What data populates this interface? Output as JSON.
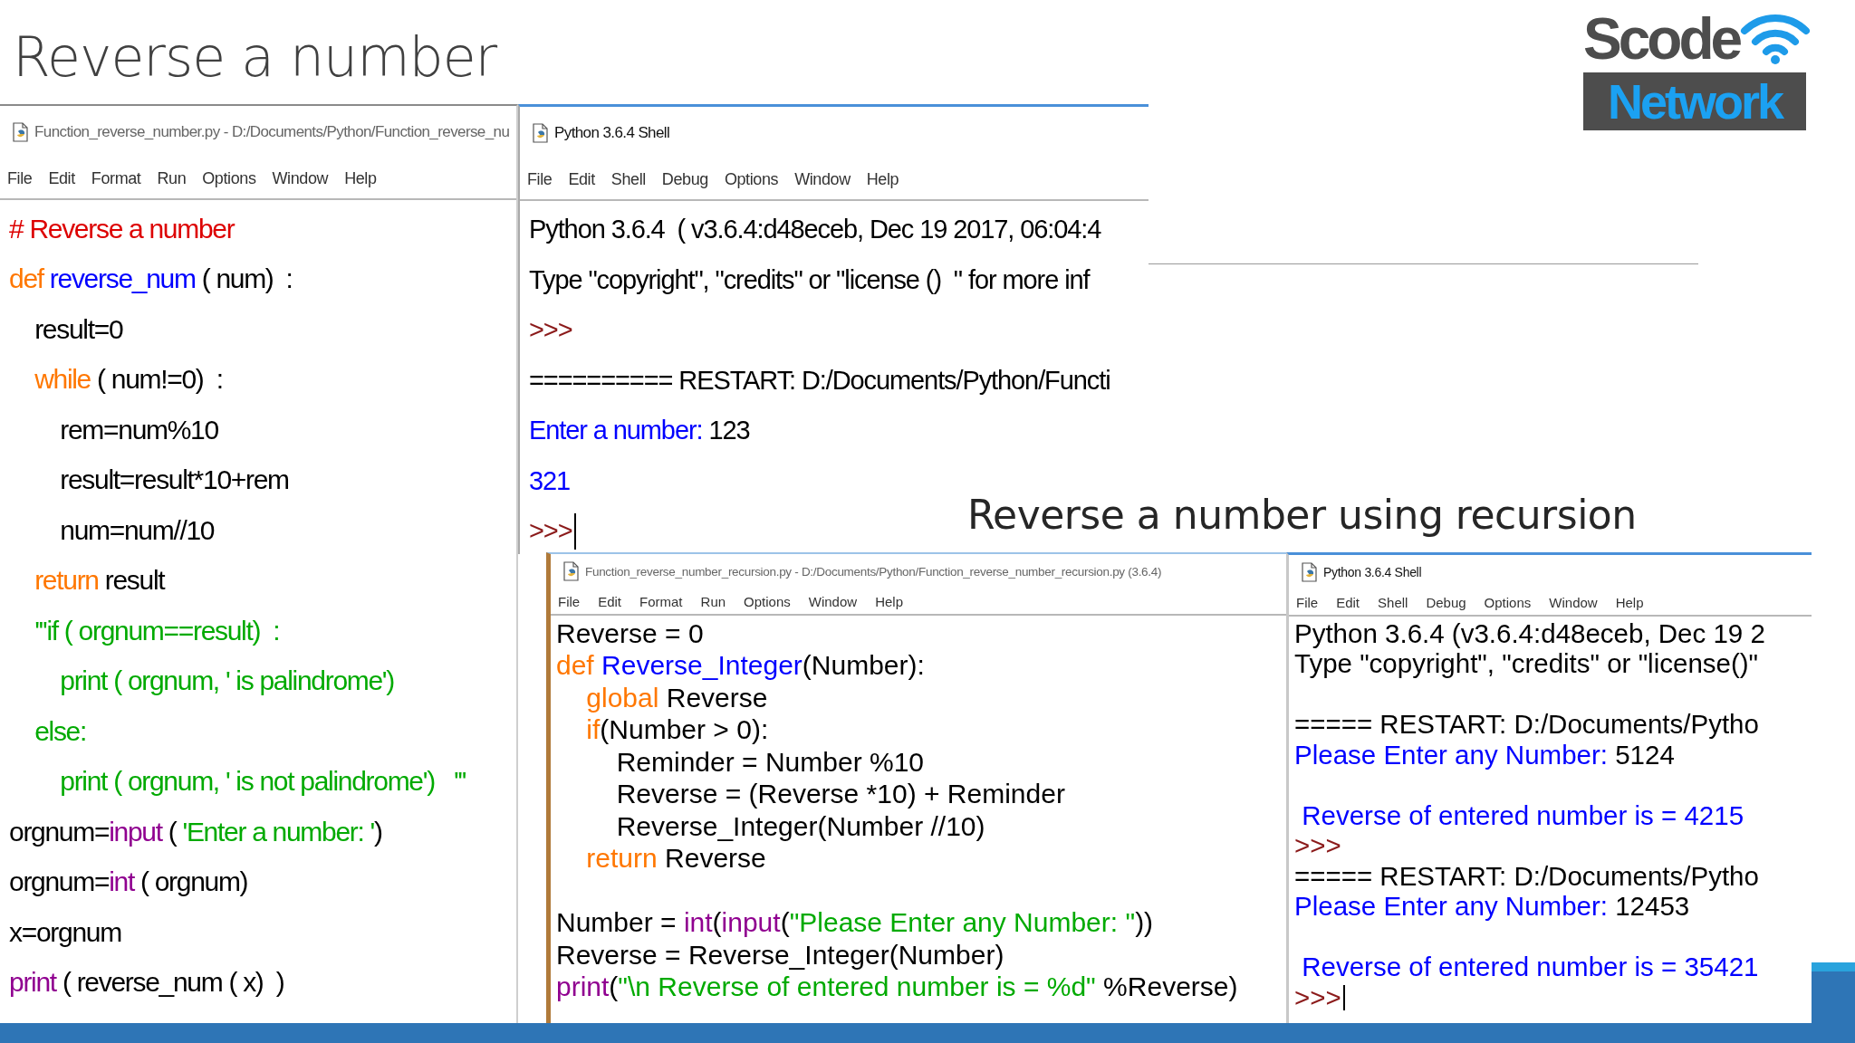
{
  "slide": {
    "title": "Reverse a number",
    "subtitle": "Reverse a number using recursion"
  },
  "logo": {
    "line_1": "Scode",
    "line_2": "Network"
  },
  "windows": [
    {
      "kind": "editor",
      "title": "Function_reverse_number.py - D:/Documents/Python/Function_reverse_nu",
      "menu": [
        "File",
        "Edit",
        "Format",
        "Run",
        "Options",
        "Window",
        "Help"
      ],
      "lines": [
        {
          "kind": "code",
          "segments": [
            {
              "kind": "comment",
              "text": "# Reverse a number"
            }
          ]
        },
        {
          "kind": "code",
          "segments": [
            {
              "kind": "keyword",
              "text": "def "
            },
            {
              "kind": "defname",
              "text": "reverse_num"
            },
            {
              "kind": "plain",
              "text": " ( num)  :"
            }
          ]
        },
        {
          "kind": "code",
          "segments": [
            {
              "kind": "plain",
              "text": "    result=0"
            }
          ]
        },
        {
          "kind": "code",
          "segments": [
            {
              "kind": "keyword",
              "text": "    while"
            },
            {
              "kind": "plain",
              "text": " ( num!=0)  :"
            }
          ]
        },
        {
          "kind": "code",
          "segments": [
            {
              "kind": "plain",
              "text": "        rem=num%10"
            }
          ]
        },
        {
          "kind": "code",
          "segments": [
            {
              "kind": "plain",
              "text": "        result=result*10+rem"
            }
          ]
        },
        {
          "kind": "code",
          "segments": [
            {
              "kind": "plain",
              "text": "        num=num//10"
            }
          ]
        },
        {
          "kind": "code",
          "segments": [
            {
              "kind": "keyword",
              "text": "    return"
            },
            {
              "kind": "plain",
              "text": " result"
            }
          ]
        },
        {
          "kind": "code",
          "segments": [
            {
              "kind": "string",
              "text": "    '''if ( orgnum==result)  :"
            }
          ]
        },
        {
          "kind": "code",
          "segments": [
            {
              "kind": "string",
              "text": "        print ( orgnum, ' is palindrome')"
            }
          ]
        },
        {
          "kind": "code",
          "segments": [
            {
              "kind": "string",
              "text": "    else:"
            }
          ]
        },
        {
          "kind": "code",
          "segments": [
            {
              "kind": "string",
              "text": "        print ( orgnum, ' is not palindrome')   '''"
            }
          ]
        },
        {
          "kind": "code",
          "segments": [
            {
              "kind": "plain",
              "text": "orgnum="
            },
            {
              "kind": "builtin",
              "text": "input"
            },
            {
              "kind": "plain",
              "text": " ( "
            },
            {
              "kind": "string",
              "text": "'Enter a number: '"
            },
            {
              "kind": "plain",
              "text": ")"
            }
          ]
        },
        {
          "kind": "code",
          "segments": [
            {
              "kind": "plain",
              "text": "orgnum="
            },
            {
              "kind": "builtin",
              "text": "int"
            },
            {
              "kind": "plain",
              "text": " ( orgnum)"
            }
          ]
        },
        {
          "kind": "code",
          "segments": [
            {
              "kind": "plain",
              "text": "x=orgnum"
            }
          ]
        },
        {
          "kind": "code",
          "segments": [
            {
              "kind": "builtin",
              "text": "print"
            },
            {
              "kind": "plain",
              "text": " ( reverse_num ( x)  )"
            }
          ]
        }
      ]
    },
    {
      "kind": "shell",
      "title": "Python 3.6.4 Shell",
      "menu": [
        "File",
        "Edit",
        "Shell",
        "Debug",
        "Options",
        "Window",
        "Help"
      ],
      "caret": true,
      "lines": [
        {
          "kind": "code",
          "segments": [
            {
              "kind": "plain",
              "text": "Python 3.6.4  ( v3.6.4:d48eceb, Dec 19 2017, 06:04:4"
            }
          ]
        },
        {
          "kind": "code",
          "segments": [
            {
              "kind": "plain",
              "text": "Type \"copyright\", \"credits\" or \"license ()  \" for more inf"
            }
          ]
        },
        {
          "kind": "code",
          "segments": [
            {
              "kind": "prompt",
              "text": ">>>"
            }
          ]
        },
        {
          "kind": "code",
          "segments": [
            {
              "kind": "plain",
              "text": "========== RESTART: D:/Documents/Python/Functi"
            }
          ]
        },
        {
          "kind": "code",
          "segments": [
            {
              "kind": "output",
              "text": "Enter a number: "
            },
            {
              "kind": "plain",
              "text": "123"
            }
          ]
        },
        {
          "kind": "code",
          "segments": [
            {
              "kind": "output",
              "text": "321"
            }
          ]
        },
        {
          "kind": "code",
          "segments": [
            {
              "kind": "prompt",
              "text": ">>>"
            }
          ]
        }
      ]
    },
    {
      "kind": "editor",
      "title": "Function_reverse_number_recursion.py - D:/Documents/Python/Function_reverse_number_recursion.py (3.6.4)",
      "menu": [
        "File",
        "Edit",
        "Format",
        "Run",
        "Options",
        "Window",
        "Help"
      ],
      "lines": [
        {
          "kind": "code",
          "segments": [
            {
              "kind": "plain",
              "text": "Reverse = 0"
            }
          ]
        },
        {
          "kind": "code",
          "segments": [
            {
              "kind": "keyword",
              "text": "def "
            },
            {
              "kind": "defname",
              "text": "Reverse_Integer"
            },
            {
              "kind": "plain",
              "text": "(Number):"
            }
          ]
        },
        {
          "kind": "code",
          "segments": [
            {
              "kind": "keyword",
              "text": "    global"
            },
            {
              "kind": "plain",
              "text": " Reverse"
            }
          ]
        },
        {
          "kind": "code",
          "segments": [
            {
              "kind": "keyword",
              "text": "    if"
            },
            {
              "kind": "plain",
              "text": "(Number > 0):"
            }
          ]
        },
        {
          "kind": "code",
          "segments": [
            {
              "kind": "plain",
              "text": "        Reminder = Number %10"
            }
          ]
        },
        {
          "kind": "code",
          "segments": [
            {
              "kind": "plain",
              "text": "        Reverse = (Reverse *10) + Reminder"
            }
          ]
        },
        {
          "kind": "code",
          "segments": [
            {
              "kind": "plain",
              "text": "        Reverse_Integer(Number //10)"
            }
          ]
        },
        {
          "kind": "code",
          "segments": [
            {
              "kind": "keyword",
              "text": "    return"
            },
            {
              "kind": "plain",
              "text": " Reverse"
            }
          ]
        },
        {
          "kind": "blank"
        },
        {
          "kind": "code",
          "segments": [
            {
              "kind": "plain",
              "text": "Number = "
            },
            {
              "kind": "builtin",
              "text": "int"
            },
            {
              "kind": "plain",
              "text": "("
            },
            {
              "kind": "builtin",
              "text": "input"
            },
            {
              "kind": "plain",
              "text": "("
            },
            {
              "kind": "string",
              "text": "\"Please Enter any Number: \""
            },
            {
              "kind": "plain",
              "text": "))"
            }
          ]
        },
        {
          "kind": "code",
          "segments": [
            {
              "kind": "plain",
              "text": "Reverse = Reverse_Integer(Number)"
            }
          ]
        },
        {
          "kind": "code",
          "segments": [
            {
              "kind": "builtin",
              "text": "print"
            },
            {
              "kind": "plain",
              "text": "("
            },
            {
              "kind": "string",
              "text": "\"\\n Reverse of entered number is = %d\""
            },
            {
              "kind": "plain",
              "text": " %Reverse)"
            }
          ]
        }
      ]
    },
    {
      "kind": "shell",
      "title": "Python 3.6.4 Shell",
      "menu": [
        "File",
        "Edit",
        "Shell",
        "Debug",
        "Options",
        "Window",
        "Help"
      ],
      "caret": true,
      "lines": [
        {
          "kind": "code",
          "segments": [
            {
              "kind": "plain",
              "text": "Python 3.6.4 (v3.6.4:d48eceb, Dec 19 2"
            }
          ]
        },
        {
          "kind": "code",
          "segments": [
            {
              "kind": "plain",
              "text": "Type \"copyright\", \"credits\" or \"license()\""
            }
          ]
        },
        {
          "kind": "blank"
        },
        {
          "kind": "code",
          "segments": [
            {
              "kind": "plain",
              "text": "===== RESTART: D:/Documents/Pytho"
            }
          ]
        },
        {
          "kind": "code",
          "segments": [
            {
              "kind": "output",
              "text": "Please Enter any Number: "
            },
            {
              "kind": "plain",
              "text": "5124"
            }
          ]
        },
        {
          "kind": "blank"
        },
        {
          "kind": "code",
          "segments": [
            {
              "kind": "output",
              "text": " Reverse of entered number is = 4215"
            }
          ]
        },
        {
          "kind": "code",
          "segments": [
            {
              "kind": "prompt",
              "text": ">>>"
            }
          ]
        },
        {
          "kind": "code",
          "segments": [
            {
              "kind": "plain",
              "text": "===== RESTART: D:/Documents/Pytho"
            }
          ]
        },
        {
          "kind": "code",
          "segments": [
            {
              "kind": "output",
              "text": "Please Enter any Number: "
            },
            {
              "kind": "plain",
              "text": "12453"
            }
          ]
        },
        {
          "kind": "blank"
        },
        {
          "kind": "code",
          "segments": [
            {
              "kind": "output",
              "text": " Reverse of entered number is = 35421"
            }
          ]
        },
        {
          "kind": "code",
          "segments": [
            {
              "kind": "prompt",
              "text": ">>>"
            }
          ]
        }
      ]
    }
  ]
}
